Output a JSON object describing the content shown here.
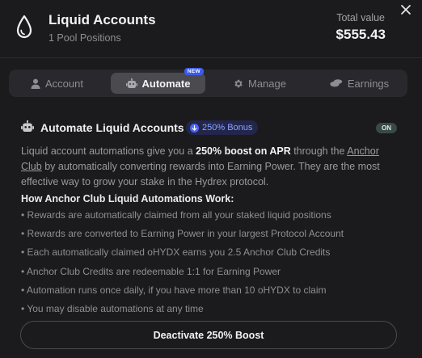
{
  "header": {
    "icon": "droplet-icon",
    "title": "Liquid Accounts",
    "subtitle": "1 Pool Positions",
    "total_label": "Total value",
    "total_value": "$555.43",
    "close_icon": "close-icon"
  },
  "tabs": [
    {
      "label": "Account",
      "icon": "user-icon",
      "active": false
    },
    {
      "label": "Automate",
      "icon": "robot-icon",
      "active": true,
      "badge": "NEW"
    },
    {
      "label": "Manage",
      "icon": "gear-icon",
      "active": false
    },
    {
      "label": "Earnings",
      "icon": "coins-icon",
      "active": false
    }
  ],
  "section": {
    "icon": "robot-icon",
    "title": "Automate Liquid Accounts",
    "bonus_badge": "250% Bonus",
    "toggle_label": "ON"
  },
  "description": {
    "part1": "Liquid account automations give you a ",
    "highlight": "250% boost on APR",
    "part2": " through the ",
    "link": "Anchor Club",
    "part3": " by automatically converting rewards into Earning Power. They are the most effective way to grow your stake in the Hydrex protocol."
  },
  "how": {
    "title": "How Anchor Club Liquid Automations Work:",
    "items": [
      "• Rewards are automatically claimed from all your staked liquid positions",
      "• Rewards are converted to Earning Power in your largest Protocol Account",
      "• Each automatically claimed oHYDX earns you 2.5 Anchor Club Credits",
      "• Anchor Club Credits are redeemable 1:1 for Earning Power",
      "• Automation runs once daily, if you have more than 10 oHYDX to claim",
      "• You may disable automations at any time"
    ]
  },
  "cta": {
    "label": "Deactivate 250% Boost"
  },
  "colors": {
    "background": "#1b1b1d",
    "accent": "#3b5bf3",
    "toggle_on": "#384a44"
  }
}
